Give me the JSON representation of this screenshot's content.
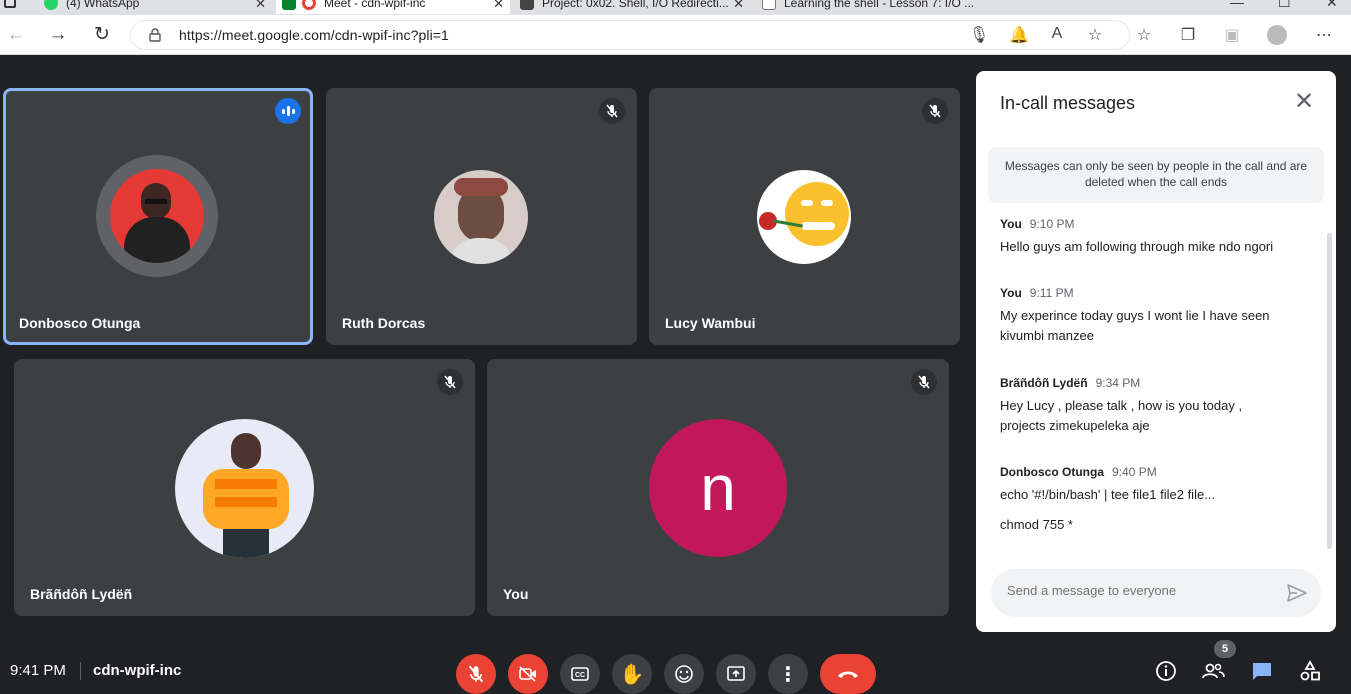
{
  "browser": {
    "tabs": [
      {
        "label": "(4) WhatsApp",
        "fav_color": "#25d366"
      },
      {
        "label": "Meet - cdn-wpif-inc",
        "fav_color": "#ea4335"
      },
      {
        "label": "Project: 0x02. Shell, I/O Redirecti...",
        "fav_color": "#444444"
      },
      {
        "label": "Learning the shell - Lesson 7: I/O ...",
        "fav_color": "#777777"
      }
    ],
    "url": "https://meet.google.com/cdn-wpif-inc?pli=1"
  },
  "participants": [
    {
      "name": "Donbosco Otunga",
      "speaking": true
    },
    {
      "name": "Ruth Dorcas",
      "muted": true
    },
    {
      "name": "Lucy Wambui",
      "muted": true
    },
    {
      "name": "Brãñdôñ Lydëñ",
      "muted": true
    },
    {
      "name": "You",
      "muted": true,
      "initial": "n",
      "avatar_color": "#c2185b"
    }
  ],
  "chat": {
    "title": "In-call messages",
    "notice": "Messages can only be seen by people in the call and are deleted when the call ends",
    "messages": [
      {
        "sender": "You",
        "time": "9:10 PM",
        "body": "Hello guys am following through mike ndo ngori"
      },
      {
        "sender": "You",
        "time": "9:11 PM",
        "body": "My experince today guys I wont lie I have seen kivumbi manzee"
      },
      {
        "sender": "Brãñdôñ Lydëñ",
        "time": "9:34 PM",
        "body": "Hey Lucy , please talk , how is you today , projects zimekupeleka aje"
      },
      {
        "sender": "Donbosco Otunga",
        "time": "9:40 PM",
        "body": "echo '#!/bin/bash' | tee file1 file2 file...",
        "body2": "chmod 755 *"
      }
    ],
    "placeholder": "Send a message to everyone"
  },
  "bottom": {
    "time": "9:41 PM",
    "meeting_code": "cdn-wpif-inc",
    "participant_count": "5"
  }
}
